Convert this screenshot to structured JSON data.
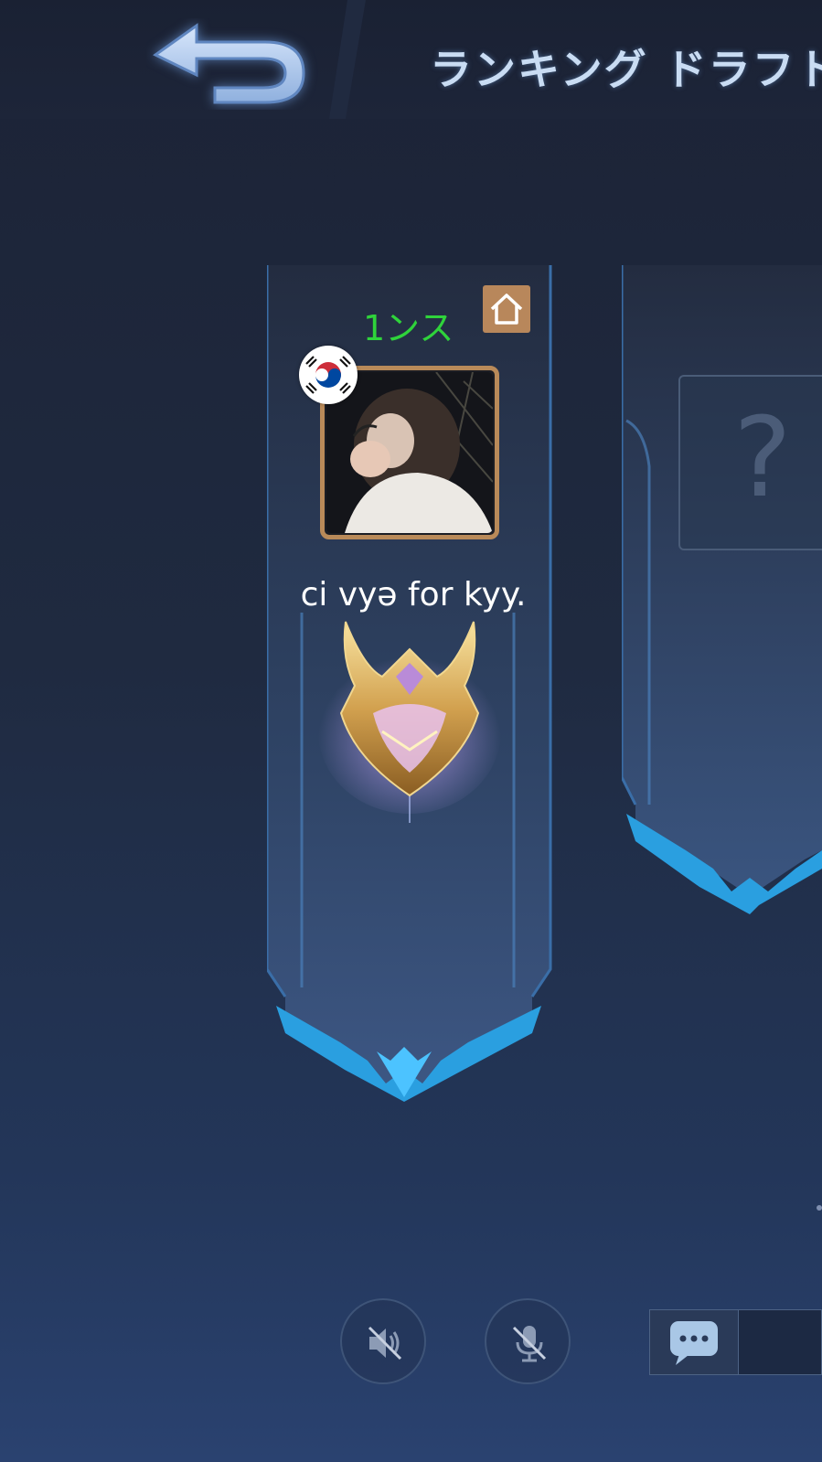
{
  "header": {
    "title": "ランキング ドラフト",
    "back_icon": "back-arrow-icon"
  },
  "player_card": {
    "status_text": "1ンス",
    "status_color": "#2fd33b",
    "home_icon": "home-icon",
    "flag_icon": "south-korea-flag-icon",
    "player_name": "ci vyə for kyy.",
    "rank_icon": "mythic-rank-emblem-icon"
  },
  "empty_slot": {
    "question_mark": "?"
  },
  "controls": {
    "speaker_icon": "speaker-muted-icon",
    "mic_icon": "mic-muted-icon",
    "chat_icon": "chat-bubble-icon"
  },
  "colors": {
    "accent_blue": "#3aa9e6",
    "frame_gold": "#b98a59",
    "home_brown": "#b8875b"
  }
}
